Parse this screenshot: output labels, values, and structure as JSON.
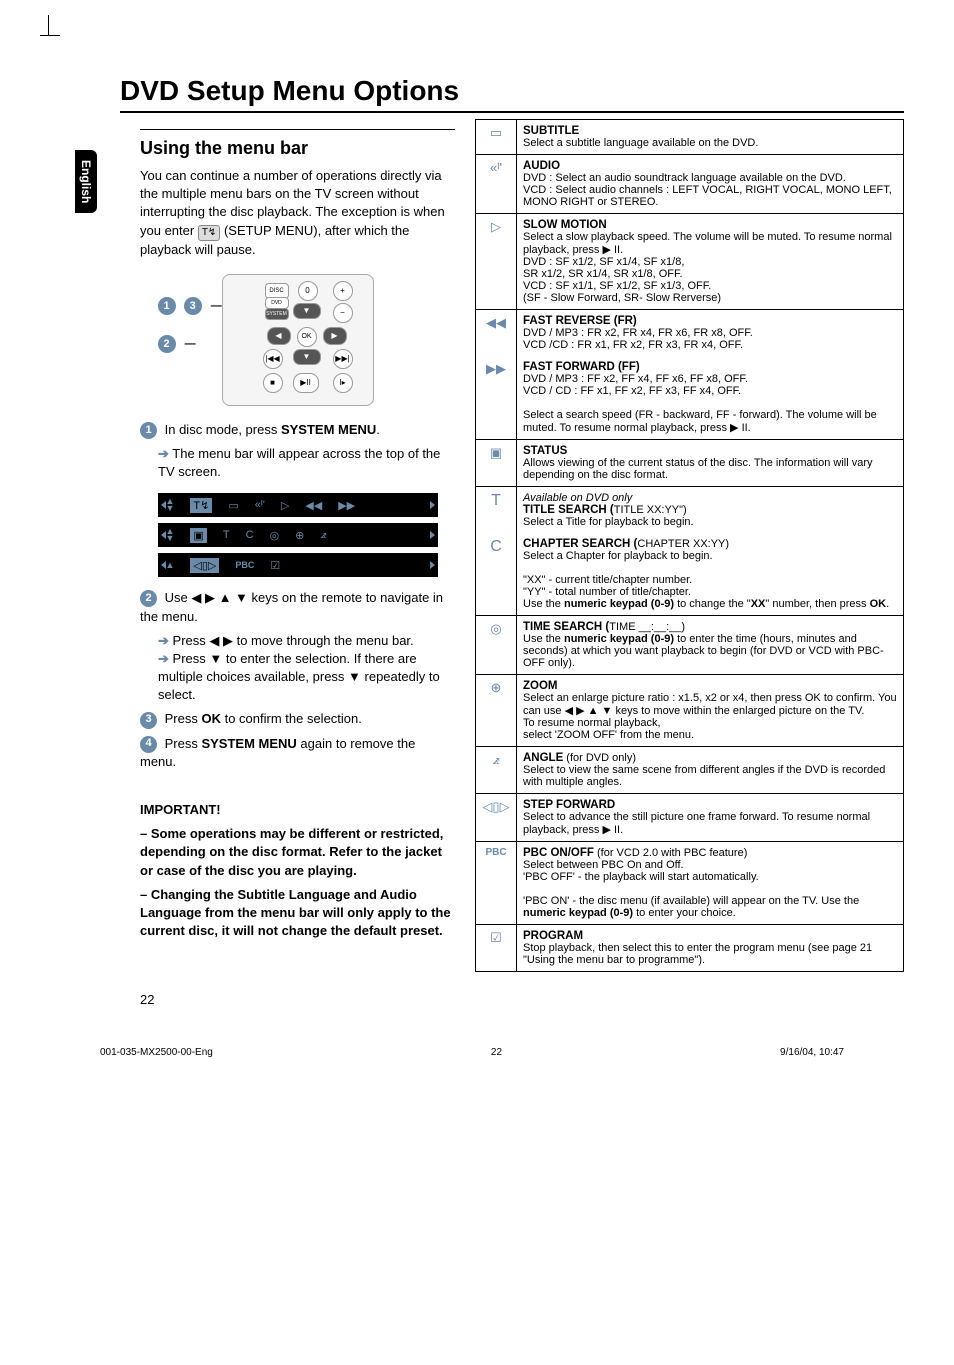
{
  "page": {
    "title": "DVD Setup Menu Options",
    "lang_tab": "English",
    "page_number": "22"
  },
  "left": {
    "heading": "Using the menu bar",
    "intro": "You can continue a number of operations directly via the multiple menu bars on the TV screen without interrupting the disc playback. The exception is when you enter",
    "intro_tail": "(SETUP MENU), after which the playback will pause.",
    "remote_labels": {
      "a": "1",
      "b": "3",
      "c": "2"
    },
    "step1_pre": "In disc mode, press ",
    "step1_bold": "SYSTEM MENU",
    "step1_post": ".",
    "step1_sub": "The menu bar will appear across the top of the TV screen.",
    "step2": "Use ◀ ▶ ▲ ▼ keys on the remote to navigate in the menu.",
    "step2_sub1": "Press ◀ ▶ to move through the menu bar.",
    "step2_sub2": "Press ▼ to enter the selection.  If there are multiple choices available, press ▼ repeatedly to select.",
    "step3_pre": "Press ",
    "step3_bold": "OK",
    "step3_post": " to confirm the selection.",
    "step4_pre": "Press ",
    "step4_bold": "SYSTEM MENU",
    "step4_post": " again to remove the menu.",
    "important_heading": "IMPORTANT!",
    "important_p1": "– Some operations may be different or restricted, depending on the disc format. Refer to the jacket or case of the disc you are playing.",
    "important_p2": "– Changing the Subtitle Language and Audio Language from the menu bar will only apply to the current disc, it will not change the default preset."
  },
  "menu_strips": {
    "row2_extra": {
      "t": "T",
      "c": "C"
    },
    "row3_pbc": "PBC"
  },
  "table": {
    "subtitle": {
      "title": "SUBTITLE",
      "body": "Select a subtitle language available on the DVD."
    },
    "audio": {
      "title": "AUDIO",
      "dvd": "DVD :  Select an audio soundtrack language available on the DVD.",
      "vcd": "VCD :  Select audio channels : LEFT VOCAL, RIGHT VOCAL, MONO LEFT, MONO RIGHT or STEREO."
    },
    "slow": {
      "title": "SLOW MOTION",
      "l1": "Select a slow playback speed. The volume will be muted.  To resume normal playback, press  ▶ II.",
      "l2": "DVD : SF x1/2, SF x1/4, SF x1/8,",
      "l3": "          SR x1/2, SR x1/4, SR x1/8, OFF.",
      "l4": "VCD : SF x1/1, SF x1/2, SF x1/3, OFF.",
      "l5": "          (SF - Slow Forward, SR- Slow Rerverse)"
    },
    "fr": {
      "title": "FAST REVERSE (FR)",
      "l1": "DVD / MP3 : FR x2, FR x4, FR x6, FR x8, OFF.",
      "l2": "VCD /CD : FR x1, FR x2, FR x3, FR x4, OFF."
    },
    "ff": {
      "title": "FAST FORWARD (FF)",
      "l1": "DVD / MP3 : FF x2, FF x4, FF x6, FF x8, OFF.",
      "l2": "VCD / CD : FF x1, FF x2, FF x3, FF x4, OFF.",
      "l3": "Select a search speed (FR - backward, FF - forward). The volume will be muted.  To resume normal playback, press  ▶ II."
    },
    "status": {
      "title": "STATUS",
      "body": "Allows viewing of the current status of the disc. The information will vary depending on the disc format."
    },
    "title_search": {
      "avail": "Available on DVD only",
      "title": "TITLE SEARCH (",
      "title_args": "TITLE XX:YY\")",
      "body": "Select a Title for playback to begin."
    },
    "chapter_search": {
      "title": "CHAPTER SEARCH (",
      "title_args": "CHAPTER XX:YY)",
      "body": "Select a Chapter for playback to begin.",
      "xx1": "\"XX\" - current title/chapter number.",
      "yy": "\"YY\" - total number of title/chapter.",
      "use_pre": "Use the ",
      "use_bold": "numeric keypad (0-9)",
      "use_mid": " to change the \"",
      "xx2": "XX",
      "use_post": "\" number, then press ",
      "ok": "OK",
      "dot": "."
    },
    "time": {
      "title": "TIME SEARCH (",
      "args": "TIME __:__:__)",
      "pre": "Use the ",
      "bold": "numeric keypad (0-9)",
      "post": " to enter the time (hours, minutes and seconds) at which you want playback to begin (for DVD or VCD with PBC-OFF only)."
    },
    "zoom": {
      "title": "ZOOM",
      "body": "Select an enlarge picture ratio : x1.5, x2 or x4, then press OK to confirm.  You can use ◀ ▶ ▲ ▼ keys to move within the enlarged picture on the TV.\nTo resume normal playback,\nselect 'ZOOM OFF' from the menu."
    },
    "angle": {
      "title": "ANGLE",
      "paren": " (for DVD only)",
      "body": "Select to view the same scene from different angles if the DVD is recorded with multiple angles."
    },
    "step": {
      "title": "STEP FORWARD",
      "body": "Select to advance the still picture one frame forward. To resume normal playback, press  ▶ II."
    },
    "pbc": {
      "title": "PBC ON/OFF",
      "paren": " (for VCD 2.0 with PBC feature)",
      "l1": "Select between PBC On and Off.",
      "l2": "'PBC OFF' - the playback will start automatically.",
      "l3_pre": "'PBC ON' - the disc menu (if available) will appear on the TV. Use the ",
      "l3_bold": "numeric keypad (0-9)",
      "l3_post": " to enter your choice."
    },
    "program": {
      "title": "PROGRAM",
      "body": "Stop playback, then select this to enter the program menu (see page 21 \"Using the menu bar to programme\")."
    }
  },
  "footer": {
    "left": "001-035-MX2500-00-Eng",
    "center": "22",
    "right": "9/16/04, 10:47"
  }
}
